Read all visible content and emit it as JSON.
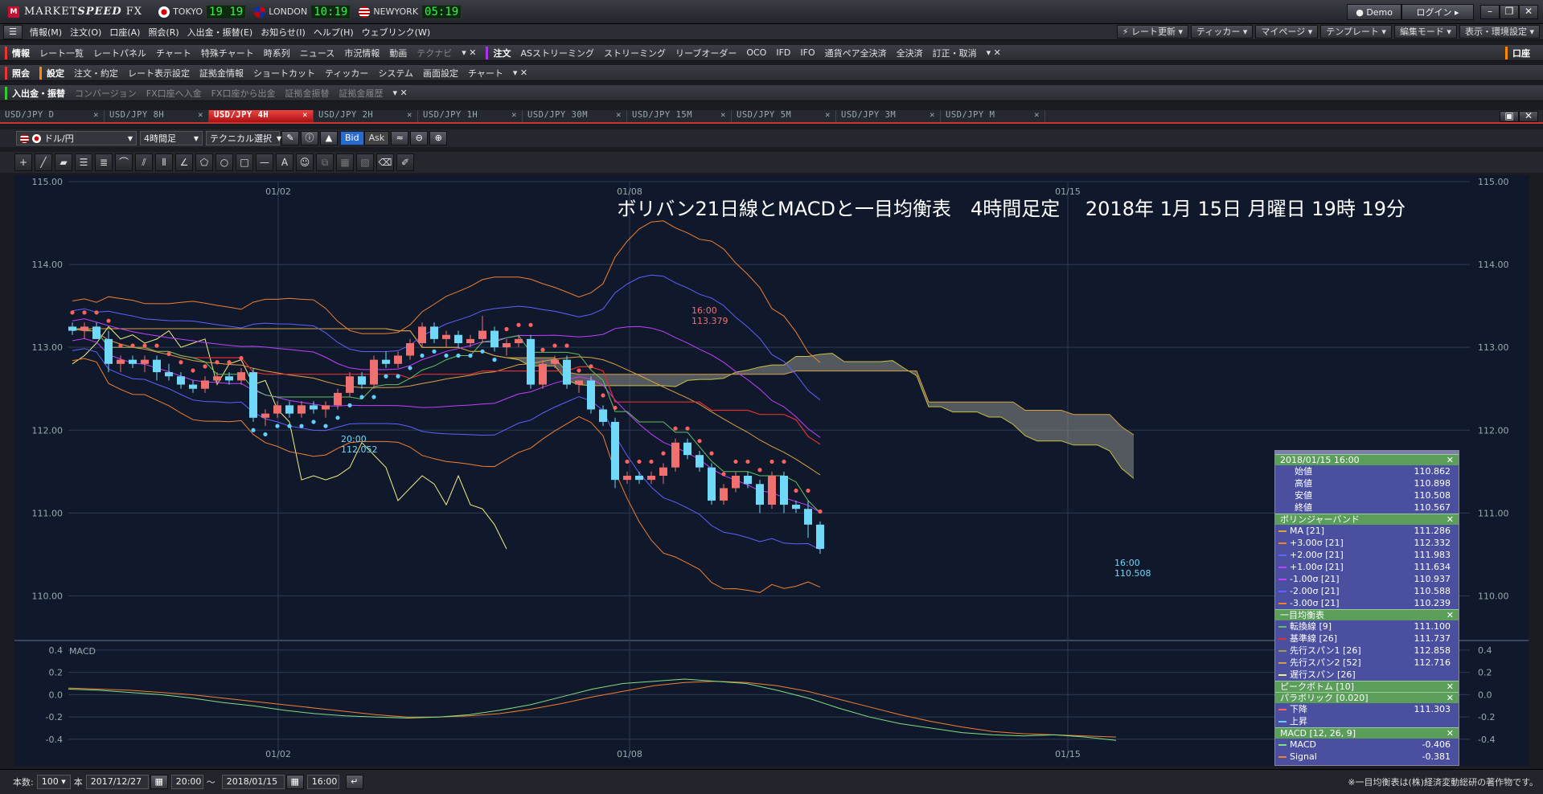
{
  "app": {
    "brand_a": "MARKET",
    "brand_b": "SPEED",
    "brand_c": " FX"
  },
  "clocks": [
    {
      "city": "TOKYO",
      "time": "19 19"
    },
    {
      "city": "LONDON",
      "time": "10:19"
    },
    {
      "city": "NEWYORK",
      "time": "05:19"
    }
  ],
  "title_buttons": {
    "demo": "Demo",
    "login": "ログイン"
  },
  "menu": [
    "情報(M)",
    "注文(O)",
    "口座(A)",
    "照会(R)",
    "入出金・振替(E)",
    "お知らせ(I)",
    "ヘルプ(H)",
    "ウェブリンク(W)"
  ],
  "menu_right": [
    "レート更新",
    "ティッカー",
    "マイページ",
    "テンプレート",
    "編集モード",
    "表示・環境設定"
  ],
  "tb1": {
    "s1": "情報",
    "items": [
      "レート一覧",
      "レートパネル",
      "チャート",
      "特殊チャート",
      "時系列",
      "ニュース",
      "市況情報",
      "動画"
    ],
    "dim": "テクナビ",
    "s2": "注文",
    "items2": [
      "ASストリーミング",
      "ストリーミング",
      "リーブオーダー",
      "OCO",
      "IFD",
      "IFO",
      "通貨ペア全決済",
      "全決済",
      "訂正・取消"
    ],
    "right": "口座"
  },
  "tb2": {
    "s1": "照会",
    "s2": "設定",
    "items": [
      "注文・約定",
      "レート表示設定",
      "証拠金情報",
      "ショートカット",
      "ティッカー",
      "システム",
      "画面設定",
      "チャート"
    ]
  },
  "tb3": {
    "s1": "入出金・振替",
    "dim": [
      "コンバージョン",
      "FX口座へ入金",
      "FX口座から出金",
      "証拠金振替",
      "証拠金履歴"
    ]
  },
  "tabs": [
    "USD/JPY D",
    "USD/JPY 8H",
    "USD/JPY 4H",
    "USD/JPY 2H",
    "USD/JPY 1H",
    "USD/JPY 30M",
    "USD/JPY 15M",
    "USD/JPY 5M",
    "USD/JPY 3M",
    "USD/JPY M"
  ],
  "ctrl": {
    "pair": "ドル/円",
    "period": "4時間足",
    "tech": "テクニカル選択",
    "bid": "Bid",
    "ask": "Ask"
  },
  "bottom": {
    "count_label": "本数:",
    "count": "100",
    "unit": "本",
    "from_date": "2017/12/27",
    "from_time": "20:00",
    "sep": "～",
    "to_date": "2018/01/15",
    "to_time": "16:00",
    "note": "※一目均衡表は(株)経済変動総研の著作物です。"
  },
  "info": {
    "head": "2018/01/15 16:00",
    "ohlc": [
      [
        "始値",
        "110.862"
      ],
      [
        "高値",
        "110.898"
      ],
      [
        "安値",
        "110.508"
      ],
      [
        "終値",
        "110.567"
      ]
    ],
    "bb_title": "ボリンジャーバンド",
    "bb": [
      [
        "MA [21]",
        "111.286",
        "#e0a040"
      ],
      [
        "+3.00σ [21]",
        "112.332",
        "#f08030"
      ],
      [
        "+2.00σ [21]",
        "111.983",
        "#6060ff"
      ],
      [
        "+1.00σ [21]",
        "111.634",
        "#c040ff"
      ],
      [
        "-1.00σ [21]",
        "110.937",
        "#c040ff"
      ],
      [
        "-2.00σ [21]",
        "110.588",
        "#6060ff"
      ],
      [
        "-3.00σ [21]",
        "110.239",
        "#f08030"
      ]
    ],
    "ich_title": "一目均衡表",
    "ich": [
      [
        "転換線 [9]",
        "111.100",
        "#60c060"
      ],
      [
        "基準線 [26]",
        "111.737",
        "#e03030"
      ],
      [
        "先行スパン1 [26]",
        "112.858",
        "#a0a040"
      ],
      [
        "先行スパン2 [52]",
        "112.716",
        "#d0a040"
      ],
      [
        "遅行スパン [26]",
        "",
        "#f0f080"
      ]
    ],
    "peak": "ピークボトム [10]",
    "para": "パラボリック [0.020]",
    "para_rows": [
      [
        "下降",
        "111.303",
        "#ff6060"
      ],
      [
        "上昇",
        "",
        "#60d0ff"
      ]
    ],
    "macd_title": "MACD [12, 26, 9]",
    "macd": [
      [
        "MACD",
        "-0.406",
        "#80e080"
      ],
      [
        "Signal",
        "-0.381",
        "#f08030"
      ]
    ]
  },
  "chart_data": {
    "type": "candlestick",
    "title": "ボリバン21日線とMACDと一目均衡表　4時間足定　 2018年 1月 15日 月曜日 19時 19分",
    "x_labels": [
      "01/02",
      "01/08",
      "01/15"
    ],
    "y_ticks": [
      "115.00",
      "114.00",
      "113.00",
      "112.00",
      "111.00",
      "110.00"
    ],
    "ylim": [
      109.5,
      115.0
    ],
    "annotations": [
      {
        "time": "16:00",
        "value": "113.379"
      },
      {
        "time": "20:00",
        "value": "112.052"
      },
      {
        "time": "16:00",
        "value": "110.508"
      }
    ],
    "ohlc": [
      [
        113.25,
        113.3,
        113.15,
        113.2
      ],
      [
        113.2,
        113.3,
        113.1,
        113.25
      ],
      [
        113.25,
        113.3,
        113.15,
        113.1
      ],
      [
        113.1,
        113.2,
        112.7,
        112.8
      ],
      [
        112.8,
        112.9,
        112.7,
        112.85
      ],
      [
        112.85,
        112.9,
        112.75,
        112.8
      ],
      [
        112.8,
        112.9,
        112.7,
        112.85
      ],
      [
        112.85,
        112.9,
        112.6,
        112.7
      ],
      [
        112.7,
        112.8,
        112.6,
        112.65
      ],
      [
        112.65,
        112.7,
        112.5,
        112.55
      ],
      [
        112.55,
        112.6,
        112.45,
        112.5
      ],
      [
        112.5,
        112.65,
        112.45,
        112.6
      ],
      [
        112.6,
        112.7,
        112.55,
        112.65
      ],
      [
        112.65,
        112.7,
        112.55,
        112.6
      ],
      [
        112.6,
        112.75,
        112.55,
        112.7
      ],
      [
        112.7,
        112.75,
        112.1,
        112.15
      ],
      [
        112.15,
        112.25,
        112.05,
        112.2
      ],
      [
        112.2,
        112.35,
        112.15,
        112.3
      ],
      [
        112.3,
        112.35,
        112.15,
        112.2
      ],
      [
        112.2,
        112.35,
        112.15,
        112.3
      ],
      [
        112.3,
        112.35,
        112.2,
        112.25
      ],
      [
        112.25,
        112.35,
        112.15,
        112.3
      ],
      [
        112.3,
        112.5,
        112.25,
        112.45
      ],
      [
        112.45,
        112.7,
        112.4,
        112.65
      ],
      [
        112.65,
        112.7,
        112.5,
        112.55
      ],
      [
        112.55,
        112.9,
        112.5,
        112.85
      ],
      [
        112.85,
        112.95,
        112.75,
        112.8
      ],
      [
        112.8,
        112.95,
        112.75,
        112.9
      ],
      [
        112.9,
        113.1,
        112.85,
        113.05
      ],
      [
        113.05,
        113.3,
        113.0,
        113.25
      ],
      [
        113.25,
        113.3,
        113.05,
        113.1
      ],
      [
        113.1,
        113.2,
        113.0,
        113.15
      ],
      [
        113.15,
        113.2,
        113.0,
        113.05
      ],
      [
        113.05,
        113.15,
        113.0,
        113.1
      ],
      [
        113.1,
        113.38,
        113.05,
        113.2
      ],
      [
        113.2,
        113.25,
        112.95,
        113.0
      ],
      [
        113.0,
        113.1,
        112.9,
        113.05
      ],
      [
        113.05,
        113.15,
        113.0,
        113.1
      ],
      [
        113.1,
        113.15,
        112.5,
        112.55
      ],
      [
        112.55,
        112.85,
        112.5,
        112.8
      ],
      [
        112.8,
        112.9,
        112.75,
        112.85
      ],
      [
        112.85,
        112.9,
        112.5,
        112.55
      ],
      [
        112.55,
        112.6,
        112.45,
        112.6
      ],
      [
        112.6,
        112.65,
        112.2,
        112.25
      ],
      [
        112.25,
        112.3,
        112.05,
        112.1
      ],
      [
        112.1,
        112.15,
        111.3,
        111.4
      ],
      [
        111.4,
        111.5,
        111.35,
        111.45
      ],
      [
        111.45,
        111.5,
        111.35,
        111.4
      ],
      [
        111.4,
        111.5,
        111.35,
        111.45
      ],
      [
        111.45,
        111.6,
        111.35,
        111.55
      ],
      [
        111.55,
        111.9,
        111.5,
        111.85
      ],
      [
        111.85,
        111.9,
        111.65,
        111.7
      ],
      [
        111.7,
        111.75,
        111.5,
        111.55
      ],
      [
        111.55,
        111.6,
        111.1,
        111.15
      ],
      [
        111.15,
        111.35,
        111.1,
        111.3
      ],
      [
        111.3,
        111.5,
        111.25,
        111.45
      ],
      [
        111.45,
        111.5,
        111.3,
        111.35
      ],
      [
        111.35,
        111.4,
        111.0,
        111.1
      ],
      [
        111.1,
        111.5,
        111.05,
        111.45
      ],
      [
        111.45,
        111.5,
        111.0,
        111.1
      ],
      [
        111.1,
        111.15,
        111.0,
        111.05
      ],
      [
        111.05,
        111.15,
        110.7,
        110.86
      ],
      [
        110.86,
        110.898,
        110.508,
        110.567
      ]
    ],
    "macd": [
      0.05,
      0.04,
      0.02,
      0.0,
      -0.03,
      -0.07,
      -0.1,
      -0.14,
      -0.17,
      -0.19,
      -0.2,
      -0.21,
      -0.2,
      -0.18,
      -0.14,
      -0.09,
      -0.02,
      0.05,
      0.1,
      0.12,
      0.14,
      0.12,
      0.1,
      0.04,
      -0.03,
      -0.12,
      -0.2,
      -0.26,
      -0.3,
      -0.34,
      -0.36,
      -0.37,
      -0.36,
      -0.38,
      -0.41
    ],
    "signal": [
      0.06,
      0.05,
      0.04,
      0.02,
      0.0,
      -0.03,
      -0.06,
      -0.09,
      -0.12,
      -0.15,
      -0.18,
      -0.2,
      -0.2,
      -0.19,
      -0.17,
      -0.13,
      -0.08,
      -0.02,
      0.03,
      0.08,
      0.11,
      0.12,
      0.11,
      0.08,
      0.03,
      -0.04,
      -0.11,
      -0.18,
      -0.24,
      -0.29,
      -0.33,
      -0.35,
      -0.36,
      -0.37,
      -0.38
    ],
    "macd_label": "MACD",
    "macd_ticks": [
      "0.4",
      "0.2",
      "0.0",
      "-0.2",
      "-0.4"
    ],
    "macd_ylim": [
      -0.48,
      0.45
    ]
  }
}
